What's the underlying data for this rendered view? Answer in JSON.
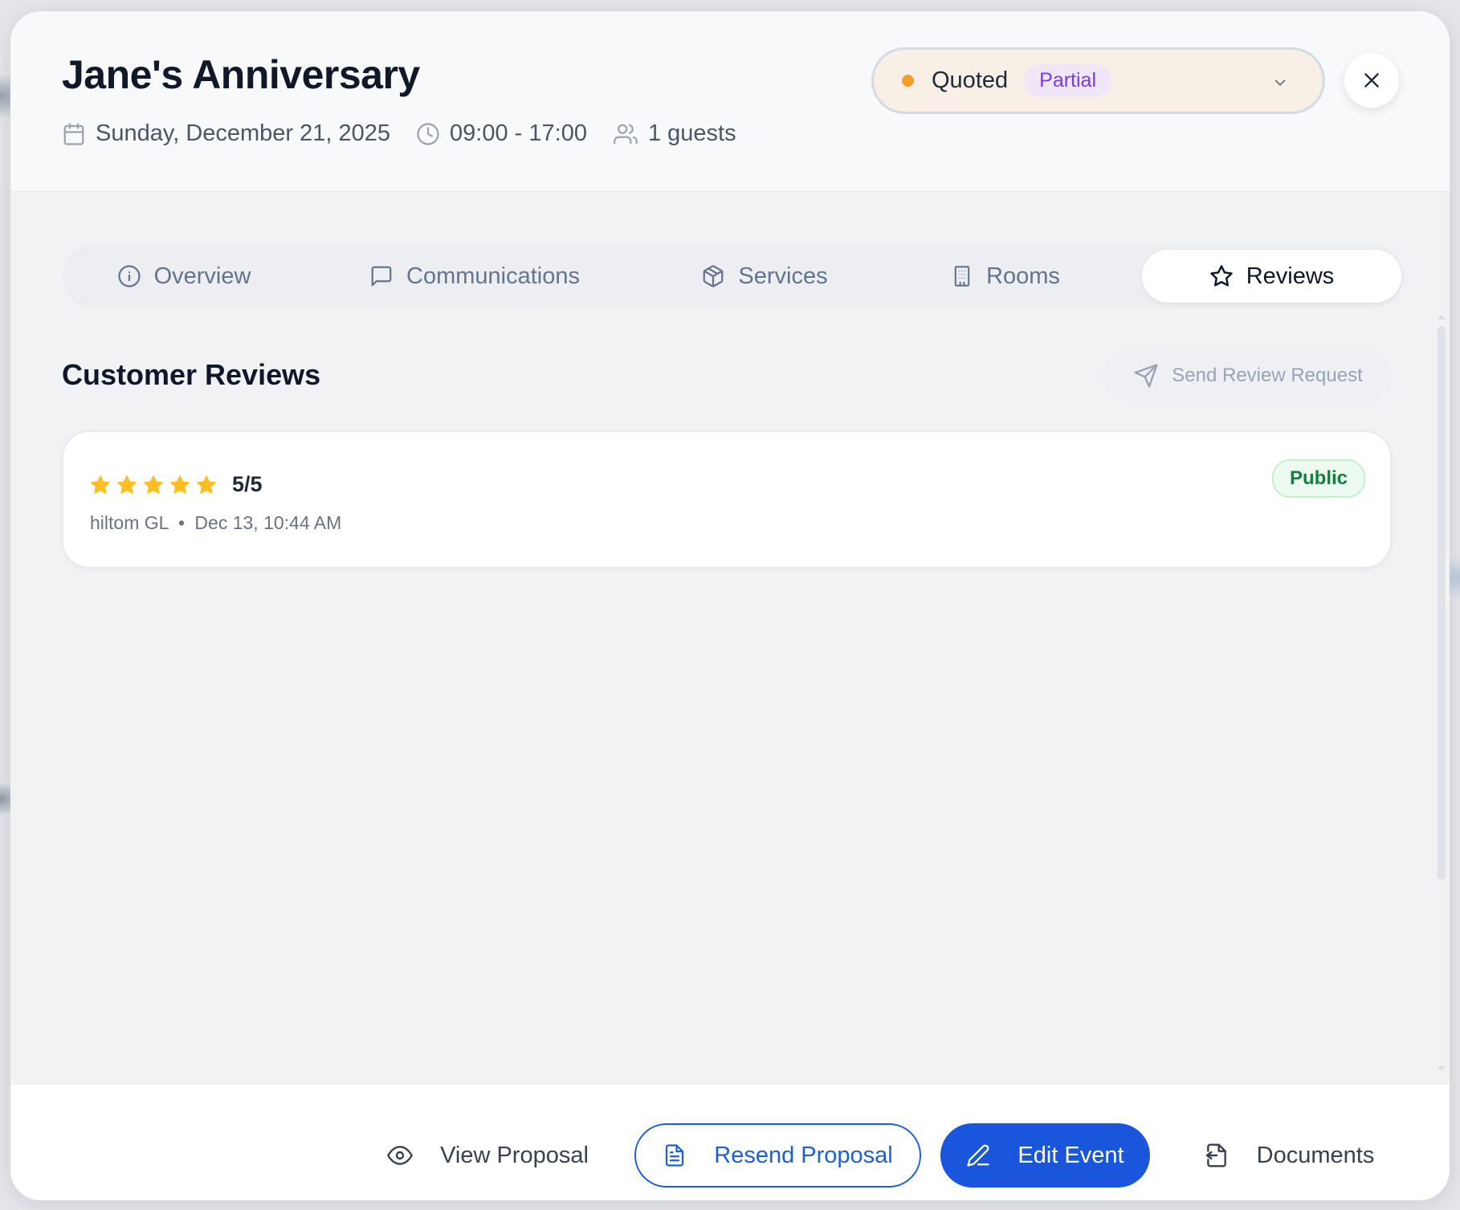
{
  "event": {
    "title": "Jane's Anniversary",
    "date": "Sunday, December 21, 2025",
    "time": "09:00 - 17:00",
    "guests": "1 guests"
  },
  "status": {
    "label": "Quoted",
    "payment_badge": "Partial",
    "dot_color": "#f59e2c"
  },
  "tabs": [
    {
      "label": "Overview",
      "icon": "info-icon",
      "active": false
    },
    {
      "label": "Communications",
      "icon": "message-icon",
      "active": false
    },
    {
      "label": "Services",
      "icon": "package-icon",
      "active": false
    },
    {
      "label": "Rooms",
      "icon": "building-icon",
      "active": false
    },
    {
      "label": "Reviews",
      "icon": "star-icon",
      "active": true
    }
  ],
  "reviews_section": {
    "title": "Customer Reviews",
    "send_request_label": "Send Review Request"
  },
  "reviews": [
    {
      "rating_stars": 5,
      "rating_text": "5/5",
      "author": "hiltom GL",
      "separator": "•",
      "datetime": "Dec 13, 10:44 AM",
      "visibility": "Public"
    }
  ],
  "footer": {
    "view_proposal": "View Proposal",
    "resend_proposal": "Resend Proposal",
    "edit_event": "Edit Event",
    "documents": "Documents"
  },
  "colors": {
    "accent": "#1a56db",
    "star": "#fbbf24",
    "partial_badge": "#7c3aed",
    "public_badge": "#15803d"
  }
}
